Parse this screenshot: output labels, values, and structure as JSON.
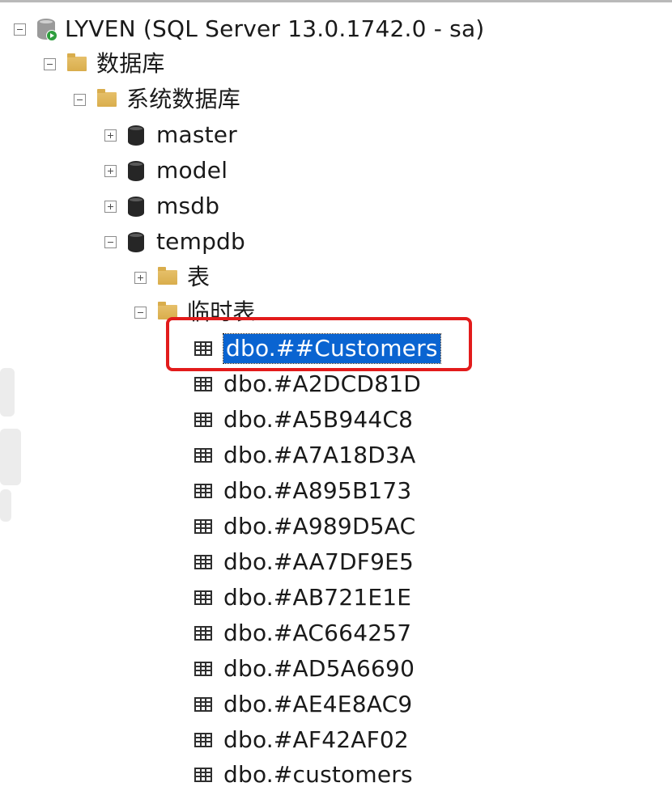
{
  "tree": {
    "server": {
      "label": "LYVEN (SQL Server 13.0.1742.0 - sa)"
    },
    "databases": {
      "label": "数据库"
    },
    "system_databases": {
      "label": "系统数据库"
    },
    "db_items": [
      {
        "label": "master",
        "expander": "plus"
      },
      {
        "label": "model",
        "expander": "plus"
      },
      {
        "label": "msdb",
        "expander": "plus"
      },
      {
        "label": "tempdb",
        "expander": "minus"
      }
    ],
    "tempdb_folders": {
      "tables": {
        "label": "表"
      },
      "temp_tables": {
        "label": "临时表"
      }
    },
    "temp_tables": [
      {
        "label": "dbo.##Customers",
        "selected": true
      },
      {
        "label": "dbo.#A2DCD81D"
      },
      {
        "label": "dbo.#A5B944C8"
      },
      {
        "label": "dbo.#A7A18D3A"
      },
      {
        "label": "dbo.#A895B173"
      },
      {
        "label": "dbo.#A989D5AC"
      },
      {
        "label": "dbo.#AA7DF9E5"
      },
      {
        "label": "dbo.#AB721E1E"
      },
      {
        "label": "dbo.#AC664257"
      },
      {
        "label": "dbo.#AD5A6690"
      },
      {
        "label": "dbo.#AE4E8AC9"
      },
      {
        "label": "dbo.#AF42AF02"
      },
      {
        "label": "dbo.#customers"
      }
    ]
  },
  "colors": {
    "selection": "#0a64d1",
    "highlight_box": "#e21b1b",
    "folder": "#d9ad4c",
    "server_running": "#2e9e3e"
  }
}
